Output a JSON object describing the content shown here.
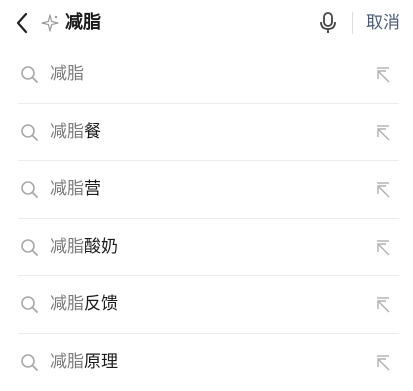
{
  "search": {
    "query": "减脂",
    "cancel_label": "取消"
  },
  "suggestions": [
    {
      "prefix": "减脂",
      "suffix": ""
    },
    {
      "prefix": "减脂",
      "suffix": "餐"
    },
    {
      "prefix": "减脂",
      "suffix": "营"
    },
    {
      "prefix": "减脂",
      "suffix": "酸奶"
    },
    {
      "prefix": "减脂",
      "suffix": "反馈"
    },
    {
      "prefix": "减脂",
      "suffix": "原理"
    }
  ],
  "icons": {
    "back": "chevron-left-icon",
    "spark": "sparkle-icon",
    "mic": "microphone-icon",
    "search": "search-icon",
    "fill": "arrow-up-left-icon"
  },
  "colors": {
    "text": "#1a1a1a",
    "muted": "#7a7a7a",
    "cancel": "#4a5a78",
    "icon": "#a8a8a8",
    "divider": "#ececec"
  }
}
